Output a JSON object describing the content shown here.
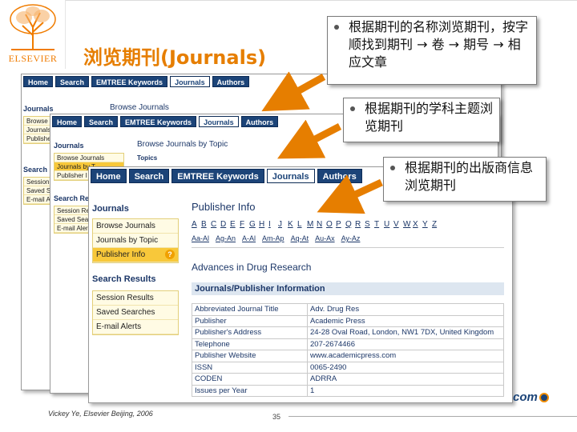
{
  "slide": {
    "title": "浏览期刊(Journals)",
    "logo_text": "ELSEVIER",
    "footer": "Vickey Ye, Elsevier Beijing, 2006",
    "page_number": "35",
    "com_logo": "com"
  },
  "callouts": [
    {
      "text": "根据期刊的名称浏览期刊，按字顺找到期刊 → 卷 → 期号 → 相应文章"
    },
    {
      "text": "根据期刊的学科主题浏览期刊"
    },
    {
      "text": "根据期刊的出版商信息浏览期刊"
    }
  ],
  "nav": {
    "home": "Home",
    "search": "Search",
    "emtree": "EMTREE Keywords",
    "journals": "Journals",
    "authors": "Authors"
  },
  "shot1": {
    "journals_head": "Journals",
    "browse_title": "Browse Journals",
    "items": [
      "Browse J",
      "Journals",
      "Publishe"
    ],
    "search_head": "Search R",
    "search_items": [
      "Session",
      "Saved Se",
      "E-mail Al"
    ]
  },
  "shot2": {
    "journals_head": "Journals",
    "browse_title": "Browse Journals by Topic",
    "topics_label": "Topics",
    "items": [
      "Browse Journals",
      "Journals by T",
      "Publisher I"
    ],
    "search_head": "Search Resul",
    "search_items": [
      "Session Res",
      "Saved Sear",
      "E-mail Aler"
    ]
  },
  "shot3": {
    "journals_head": "Journals",
    "items": [
      "Browse Journals",
      "Journals by Topic",
      "Publisher Info"
    ],
    "help": "?",
    "search_head": "Search Results",
    "search_items": [
      "Session Results",
      "Saved Searches",
      "E-mail Alerts"
    ],
    "pub_title": "Publisher Info",
    "letters": [
      "A",
      "B",
      "C",
      "D",
      "E",
      "F",
      "G",
      "H",
      "I",
      "J",
      "K",
      "L",
      "M",
      "N",
      "O",
      "P",
      "Q",
      "R",
      "S",
      "T",
      "U",
      "V",
      "W",
      "X",
      "Y",
      "Z"
    ],
    "ranges": [
      "Aa-Al",
      "Ag-An",
      "A-Al",
      "Am-Ap",
      "Aq-At",
      "Au-Ax",
      "Ay-Az"
    ],
    "journal_name": "Advances in Drug Research",
    "info_header": "Journals/Publisher Information",
    "info": [
      {
        "k": "Abbreviated Journal Title",
        "v": "Adv. Drug Res"
      },
      {
        "k": "Publisher",
        "v": "Academic Press"
      },
      {
        "k": "Publisher's Address",
        "v": "24-28 Oval Road, London, NW1 7DX, United Kingdom"
      },
      {
        "k": "Telephone",
        "v": "207-2674466"
      },
      {
        "k": "Publisher Website",
        "v": "www.academicpress.com"
      },
      {
        "k": "ISSN",
        "v": "0065-2490"
      },
      {
        "k": "CODEN",
        "v": "ADRRA"
      },
      {
        "k": "Issues per Year",
        "v": "1"
      }
    ]
  },
  "colors": {
    "title_orange": "#e67e00",
    "nav_blue": "#1c4478",
    "sidebar_yellow": "#fffbe4",
    "selected": "#f8c83a"
  }
}
